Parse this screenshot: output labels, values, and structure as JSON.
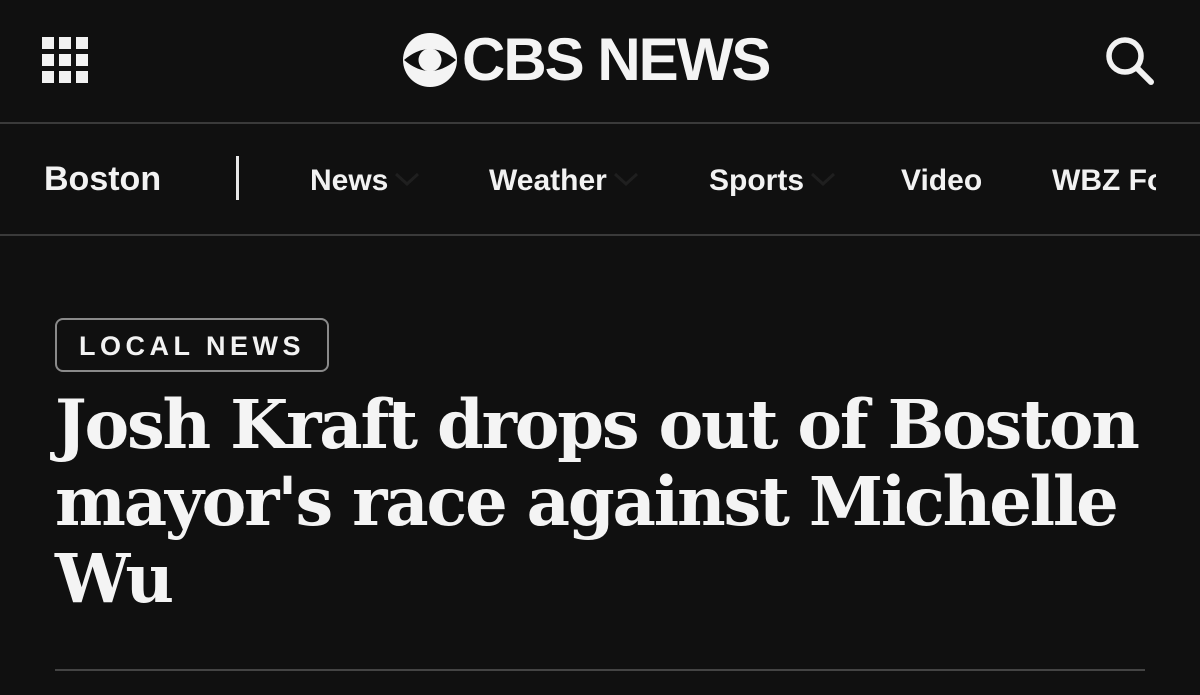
{
  "header": {
    "logo_text": "CBS NEWS",
    "menu_icon": "apps-grid-icon",
    "search_icon": "search-icon",
    "logo_icon": "cbs-eye-icon"
  },
  "nav": {
    "home_label": "Boston",
    "items": [
      {
        "label": "News",
        "has_dropdown": true
      },
      {
        "label": "Weather",
        "has_dropdown": true
      },
      {
        "label": "Sports",
        "has_dropdown": true
      },
      {
        "label": "Video",
        "has_dropdown": false
      },
      {
        "label": "WBZ Fo",
        "has_dropdown": false
      }
    ]
  },
  "article": {
    "tag": "LOCAL NEWS",
    "headline": "Josh Kraft drops out of Boston mayor's race against Michelle Wu"
  },
  "colors": {
    "background": "#101010",
    "text": "#f2f2f2",
    "divider": "#3a3a3a",
    "tag_border": "#8a8a8a"
  }
}
